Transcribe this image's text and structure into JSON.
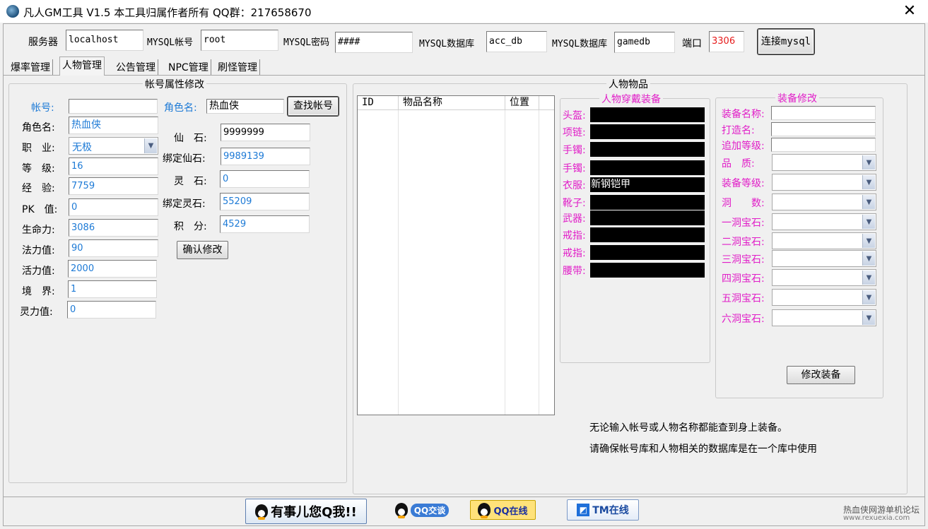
{
  "window": {
    "title": "凡人GM工具 V1.5 本工具归属作者所有 QQ群：217658670",
    "close": "✕"
  },
  "connection": {
    "server_label": "服务器",
    "server": "localhost",
    "user_label": "MYSQL帐号",
    "user": "root",
    "password_label": "MYSQL密码",
    "password": "####",
    "db_label": "MYSQL数据库",
    "db": "acc_db",
    "db2_label": "MYSQL数据库",
    "db2": "gamedb",
    "port_label": "端口",
    "port": "3306",
    "connect_button": "连接mysql"
  },
  "tabs": [
    "爆率管理",
    "人物管理",
    "公告管理",
    "NPC管理",
    "刷怪管理"
  ],
  "account": {
    "group_title": "帐号属性修改",
    "account_label": "帐号:",
    "account_value": "",
    "role_label": "角色名:",
    "role_value": "热血侠",
    "find_button": "查找帐号",
    "left_fields": [
      {
        "label": "角色名:",
        "value": "热血侠"
      },
      {
        "label": "职　业:",
        "value": "无极"
      },
      {
        "label": "等　级:",
        "value": "16"
      },
      {
        "label": "经　验:",
        "value": "7759"
      },
      {
        "label": "PK　值:",
        "value": "0"
      },
      {
        "label": "生命力:",
        "value": "3086"
      },
      {
        "label": "法力值:",
        "value": "90"
      },
      {
        "label": "活力值:",
        "value": "2000"
      },
      {
        "label": "境　界:",
        "value": "1"
      },
      {
        "label": "灵力值:",
        "value": "0"
      }
    ],
    "right_fields": [
      {
        "label": "仙　石:",
        "value": "9999999"
      },
      {
        "label": "绑定仙石:",
        "value": "9989139"
      },
      {
        "label": "灵　石:",
        "value": "0"
      },
      {
        "label": "绑定灵石:",
        "value": "55209"
      },
      {
        "label": "积　分:",
        "value": "4529"
      }
    ],
    "confirm_button": "确认修改"
  },
  "items": {
    "group_title": "人物物品",
    "columns": [
      "ID",
      "物品名称",
      "位置"
    ],
    "equipped_title": "人物穿戴装备",
    "slots": [
      {
        "label": "头盔:",
        "value": ""
      },
      {
        "label": "项链:",
        "value": ""
      },
      {
        "label": "手镯:",
        "value": ""
      },
      {
        "label": "手镯:",
        "value": ""
      },
      {
        "label": "衣服:",
        "value": "新钢铠甲"
      },
      {
        "label": "靴子:",
        "value": ""
      },
      {
        "label": "武器:",
        "value": ""
      },
      {
        "label": "戒指:",
        "value": ""
      },
      {
        "label": "戒指:",
        "value": ""
      },
      {
        "label": "腰带:",
        "value": ""
      }
    ],
    "modify_title": "装备修改",
    "text_fields": [
      "装备名称:",
      "打造名:",
      "追加等级:"
    ],
    "combo_fields": [
      "品　质:",
      "装备等级:",
      "洞　　数:",
      "一洞宝石:",
      "二洞宝石:",
      "三洞宝石:",
      "四洞宝石:",
      "五洞宝石:",
      "六洞宝石:"
    ],
    "modify_button": "修改装备",
    "note1": "无论输入帐号或人物名称都能查到身上装备。",
    "note2": "请确保帐号库和人物相关的数据库是在一个库中使用"
  },
  "footer": {
    "qq_msg": "有事儿您Q我!!",
    "qq_chat": "QQ交谈",
    "qq_online": "QQ在线",
    "tm_online": "TM在线",
    "watermark_top": "热血侠网游单机论坛",
    "watermark_bottom": "www.rexuexia.com"
  }
}
